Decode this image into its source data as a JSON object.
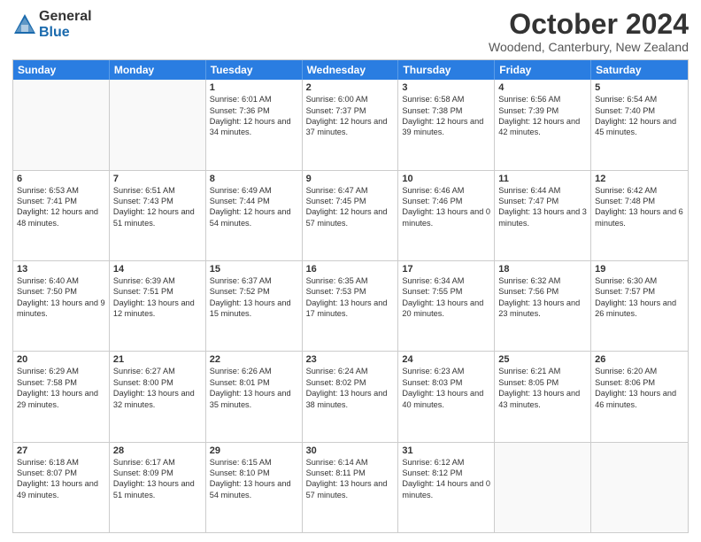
{
  "logo": {
    "general": "General",
    "blue": "Blue"
  },
  "header": {
    "month": "October 2024",
    "location": "Woodend, Canterbury, New Zealand"
  },
  "days": [
    "Sunday",
    "Monday",
    "Tuesday",
    "Wednesday",
    "Thursday",
    "Friday",
    "Saturday"
  ],
  "weeks": [
    [
      {
        "num": "",
        "sunrise": "",
        "sunset": "",
        "daylight": ""
      },
      {
        "num": "",
        "sunrise": "",
        "sunset": "",
        "daylight": ""
      },
      {
        "num": "1",
        "sunrise": "Sunrise: 6:01 AM",
        "sunset": "Sunset: 7:36 PM",
        "daylight": "Daylight: 12 hours and 34 minutes."
      },
      {
        "num": "2",
        "sunrise": "Sunrise: 6:00 AM",
        "sunset": "Sunset: 7:37 PM",
        "daylight": "Daylight: 12 hours and 37 minutes."
      },
      {
        "num": "3",
        "sunrise": "Sunrise: 6:58 AM",
        "sunset": "Sunset: 7:38 PM",
        "daylight": "Daylight: 12 hours and 39 minutes."
      },
      {
        "num": "4",
        "sunrise": "Sunrise: 6:56 AM",
        "sunset": "Sunset: 7:39 PM",
        "daylight": "Daylight: 12 hours and 42 minutes."
      },
      {
        "num": "5",
        "sunrise": "Sunrise: 6:54 AM",
        "sunset": "Sunset: 7:40 PM",
        "daylight": "Daylight: 12 hours and 45 minutes."
      }
    ],
    [
      {
        "num": "6",
        "sunrise": "Sunrise: 6:53 AM",
        "sunset": "Sunset: 7:41 PM",
        "daylight": "Daylight: 12 hours and 48 minutes."
      },
      {
        "num": "7",
        "sunrise": "Sunrise: 6:51 AM",
        "sunset": "Sunset: 7:43 PM",
        "daylight": "Daylight: 12 hours and 51 minutes."
      },
      {
        "num": "8",
        "sunrise": "Sunrise: 6:49 AM",
        "sunset": "Sunset: 7:44 PM",
        "daylight": "Daylight: 12 hours and 54 minutes."
      },
      {
        "num": "9",
        "sunrise": "Sunrise: 6:47 AM",
        "sunset": "Sunset: 7:45 PM",
        "daylight": "Daylight: 12 hours and 57 minutes."
      },
      {
        "num": "10",
        "sunrise": "Sunrise: 6:46 AM",
        "sunset": "Sunset: 7:46 PM",
        "daylight": "Daylight: 13 hours and 0 minutes."
      },
      {
        "num": "11",
        "sunrise": "Sunrise: 6:44 AM",
        "sunset": "Sunset: 7:47 PM",
        "daylight": "Daylight: 13 hours and 3 minutes."
      },
      {
        "num": "12",
        "sunrise": "Sunrise: 6:42 AM",
        "sunset": "Sunset: 7:48 PM",
        "daylight": "Daylight: 13 hours and 6 minutes."
      }
    ],
    [
      {
        "num": "13",
        "sunrise": "Sunrise: 6:40 AM",
        "sunset": "Sunset: 7:50 PM",
        "daylight": "Daylight: 13 hours and 9 minutes."
      },
      {
        "num": "14",
        "sunrise": "Sunrise: 6:39 AM",
        "sunset": "Sunset: 7:51 PM",
        "daylight": "Daylight: 13 hours and 12 minutes."
      },
      {
        "num": "15",
        "sunrise": "Sunrise: 6:37 AM",
        "sunset": "Sunset: 7:52 PM",
        "daylight": "Daylight: 13 hours and 15 minutes."
      },
      {
        "num": "16",
        "sunrise": "Sunrise: 6:35 AM",
        "sunset": "Sunset: 7:53 PM",
        "daylight": "Daylight: 13 hours and 17 minutes."
      },
      {
        "num": "17",
        "sunrise": "Sunrise: 6:34 AM",
        "sunset": "Sunset: 7:55 PM",
        "daylight": "Daylight: 13 hours and 20 minutes."
      },
      {
        "num": "18",
        "sunrise": "Sunrise: 6:32 AM",
        "sunset": "Sunset: 7:56 PM",
        "daylight": "Daylight: 13 hours and 23 minutes."
      },
      {
        "num": "19",
        "sunrise": "Sunrise: 6:30 AM",
        "sunset": "Sunset: 7:57 PM",
        "daylight": "Daylight: 13 hours and 26 minutes."
      }
    ],
    [
      {
        "num": "20",
        "sunrise": "Sunrise: 6:29 AM",
        "sunset": "Sunset: 7:58 PM",
        "daylight": "Daylight: 13 hours and 29 minutes."
      },
      {
        "num": "21",
        "sunrise": "Sunrise: 6:27 AM",
        "sunset": "Sunset: 8:00 PM",
        "daylight": "Daylight: 13 hours and 32 minutes."
      },
      {
        "num": "22",
        "sunrise": "Sunrise: 6:26 AM",
        "sunset": "Sunset: 8:01 PM",
        "daylight": "Daylight: 13 hours and 35 minutes."
      },
      {
        "num": "23",
        "sunrise": "Sunrise: 6:24 AM",
        "sunset": "Sunset: 8:02 PM",
        "daylight": "Daylight: 13 hours and 38 minutes."
      },
      {
        "num": "24",
        "sunrise": "Sunrise: 6:23 AM",
        "sunset": "Sunset: 8:03 PM",
        "daylight": "Daylight: 13 hours and 40 minutes."
      },
      {
        "num": "25",
        "sunrise": "Sunrise: 6:21 AM",
        "sunset": "Sunset: 8:05 PM",
        "daylight": "Daylight: 13 hours and 43 minutes."
      },
      {
        "num": "26",
        "sunrise": "Sunrise: 6:20 AM",
        "sunset": "Sunset: 8:06 PM",
        "daylight": "Daylight: 13 hours and 46 minutes."
      }
    ],
    [
      {
        "num": "27",
        "sunrise": "Sunrise: 6:18 AM",
        "sunset": "Sunset: 8:07 PM",
        "daylight": "Daylight: 13 hours and 49 minutes."
      },
      {
        "num": "28",
        "sunrise": "Sunrise: 6:17 AM",
        "sunset": "Sunset: 8:09 PM",
        "daylight": "Daylight: 13 hours and 51 minutes."
      },
      {
        "num": "29",
        "sunrise": "Sunrise: 6:15 AM",
        "sunset": "Sunset: 8:10 PM",
        "daylight": "Daylight: 13 hours and 54 minutes."
      },
      {
        "num": "30",
        "sunrise": "Sunrise: 6:14 AM",
        "sunset": "Sunset: 8:11 PM",
        "daylight": "Daylight: 13 hours and 57 minutes."
      },
      {
        "num": "31",
        "sunrise": "Sunrise: 6:12 AM",
        "sunset": "Sunset: 8:12 PM",
        "daylight": "Daylight: 14 hours and 0 minutes."
      },
      {
        "num": "",
        "sunrise": "",
        "sunset": "",
        "daylight": ""
      },
      {
        "num": "",
        "sunrise": "",
        "sunset": "",
        "daylight": ""
      }
    ]
  ]
}
